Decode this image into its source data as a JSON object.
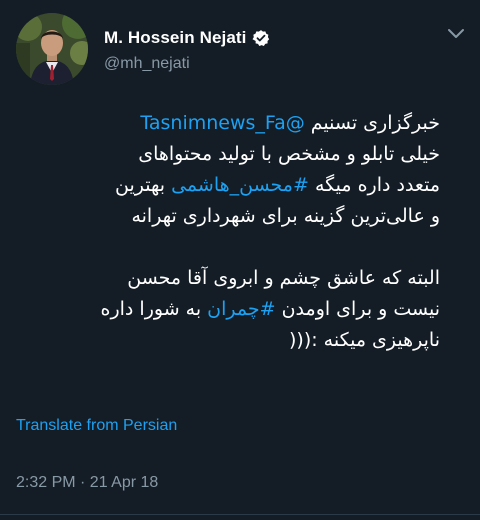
{
  "user": {
    "display_name": "M. Hossein Nejati",
    "handle": "@mh_nejati",
    "verified": true,
    "avatar_icon": "profile-photo"
  },
  "tweet": {
    "lines": [
      [
        {
          "text": "خبرگزاری تسنیم ",
          "link": false
        },
        {
          "text": "@Tasnimnews_Fa",
          "link": true
        }
      ],
      [
        {
          "text": "خیلی تابلو و مشخص با تولید محتواهای",
          "link": false
        }
      ],
      [
        {
          "text": "متعدد داره میگه ",
          "link": false
        },
        {
          "text": "#محسن_هاشمی",
          "link": true
        },
        {
          "text": " بهترین",
          "link": false
        }
      ],
      [
        {
          "text": "و عالی‌ترین گزینه برای شهرداری تهرانه",
          "link": false
        }
      ],
      [],
      [
        {
          "text": "البته که عاشق چشم و ابروی آقا محسن",
          "link": false
        }
      ],
      [
        {
          "text": "نیست و برای اومدن ",
          "link": false
        },
        {
          "text": "#چمران",
          "link": true
        },
        {
          "text": " به شورا داره",
          "link": false
        }
      ],
      [
        {
          "text": "ناپرهیزی میکنه :(((",
          "link": false
        }
      ]
    ],
    "translate_label": "Translate from Persian",
    "timestamp": "2:32 PM · 21 Apr 18"
  },
  "colors": {
    "background": "#141d26",
    "link": "#1da1f2",
    "secondary": "#8899a6",
    "text": "#ffffff"
  },
  "icons": {
    "verified": "verified-badge-icon",
    "menu": "chevron-down-icon"
  }
}
